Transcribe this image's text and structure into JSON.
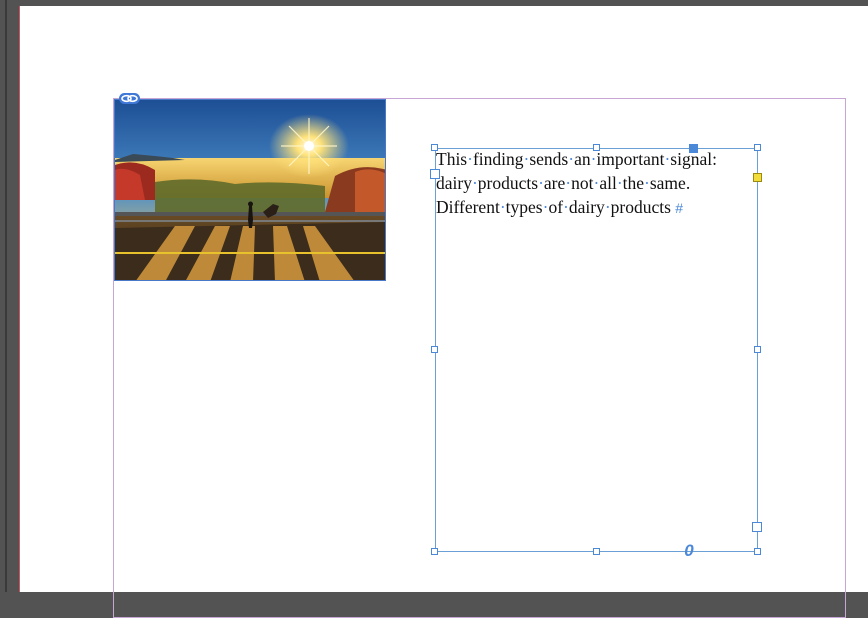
{
  "document": {
    "text_frame": {
      "lines": [
        "This finding sends an important signal:",
        "dairy products are not all the same.",
        "Different types of dairy products"
      ],
      "end_marker": "#",
      "overset_marker": "0"
    },
    "image_frame": {
      "description_icon": "linked-image-badge"
    }
  },
  "colors": {
    "selection": "#4c88d8",
    "margin_guide": "#c7a6d6",
    "pasteboard": "#535353"
  }
}
